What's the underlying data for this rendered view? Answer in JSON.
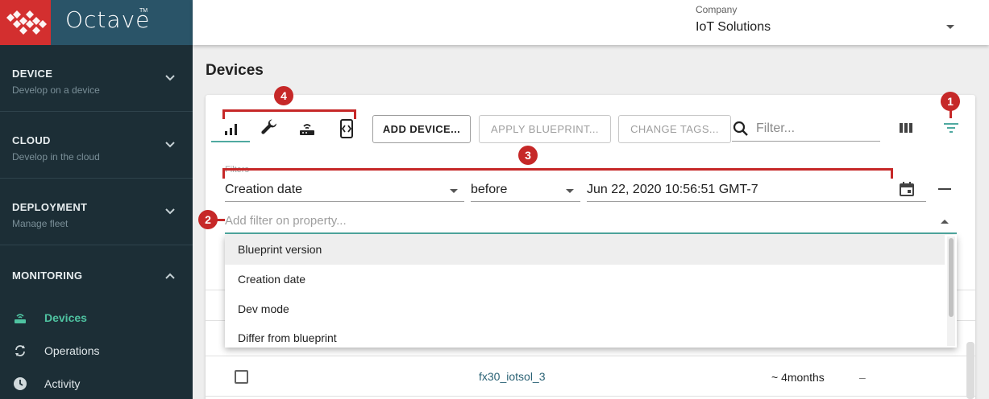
{
  "brand": {
    "name": "Octave",
    "tm": "TM",
    "logo_color": "#d32f2f",
    "accent": "#4fa9a0"
  },
  "sidebar": {
    "sections": [
      {
        "title": "DEVICE",
        "subtitle": "Develop on a device",
        "icon": "chevron-down-icon"
      },
      {
        "title": "CLOUD",
        "subtitle": "Develop in the cloud",
        "icon": "chevron-down-icon"
      },
      {
        "title": "DEPLOYMENT",
        "subtitle": "Manage fleet",
        "icon": "chevron-down-icon"
      }
    ],
    "monitoring": {
      "title": "MONITORING",
      "icon": "chevron-up-icon",
      "items": [
        {
          "label": "Devices",
          "icon": "router-icon",
          "active": true
        },
        {
          "label": "Operations",
          "icon": "sync-icon",
          "active": false
        },
        {
          "label": "Activity",
          "icon": "clock-icon",
          "active": false
        }
      ]
    }
  },
  "topbar": {
    "company_label": "Company",
    "company_value": "IoT Solutions"
  },
  "page": {
    "title": "Devices"
  },
  "toolbar": {
    "tabs": [
      {
        "icon": "signal-bars-icon",
        "selected": true
      },
      {
        "icon": "wrench-icon",
        "selected": false
      },
      {
        "icon": "router-icon",
        "selected": false
      },
      {
        "icon": "code-device-icon",
        "selected": false
      }
    ],
    "add_device": "ADD DEVICE...",
    "apply_blueprint": "APPLY BLUEPRINT...",
    "change_tags": "CHANGE TAGS...",
    "search_placeholder": "Filter..."
  },
  "filters": {
    "label": "Filters",
    "property": "Creation date",
    "operator": "before",
    "value": "Jun 22, 2020 10:56:51 GMT-7",
    "add_placeholder": "Add filter on property..."
  },
  "dropdown": {
    "options": [
      "Blueprint version",
      "Creation date",
      "Dev mode",
      "Differ from blueprint"
    ],
    "highlighted": "Blueprint version"
  },
  "table": {
    "rows": [
      {
        "name": "fx30_iotsol_3",
        "age": "~ 4months",
        "extra": "–"
      }
    ]
  },
  "callouts": [
    "1",
    "2",
    "3",
    "4"
  ]
}
